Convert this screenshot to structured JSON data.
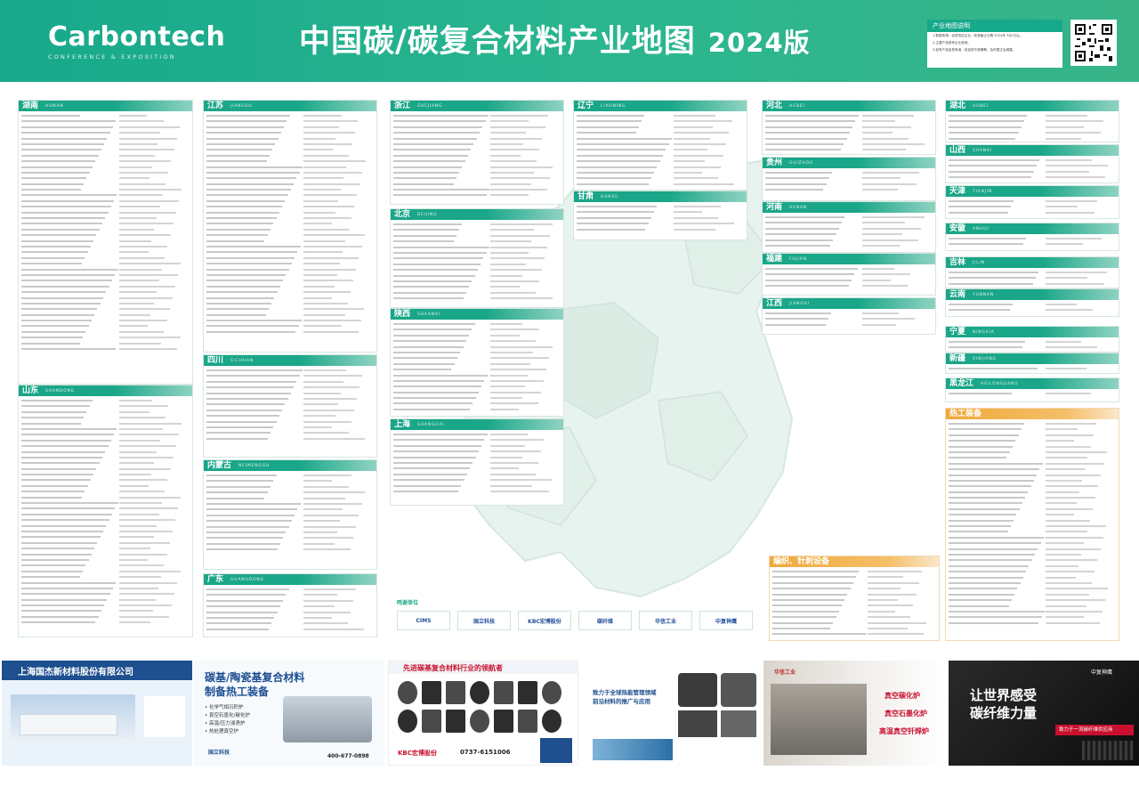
{
  "header": {
    "logo_main": "Carbontech",
    "logo_sub": "CONFERENCE & EXPOSITION",
    "title": "中国碳/碳复合材料产业地图",
    "year": "2024版",
    "note_title": "产业地图说明",
    "note_lines": [
      "1.数据来源：优质供应企业，收录截止日期 2024年 3月1日止。",
      "2.主要产品参考企业官网。",
      "3.如有产品信息有误，欢迎您不吝赐教，及时更正及调整。"
    ]
  },
  "regions": [
    {
      "name": "湖南",
      "en": "HUNAN",
      "rows": 42
    },
    {
      "name": "山东",
      "en": "SHANDONG",
      "rows": 40
    },
    {
      "name": "江苏",
      "en": "JIANGSU",
      "rows": 39
    },
    {
      "name": "四川",
      "en": "SICHUAN",
      "rows": 13
    },
    {
      "name": "内蒙古",
      "en": "NEIMENGGU",
      "rows": 14
    },
    {
      "name": "广东",
      "en": "GUANGDONG",
      "rows": 8
    },
    {
      "name": "浙江",
      "en": "ZHEJIANG",
      "rows": 15
    },
    {
      "name": "北京",
      "en": "BEIJING",
      "rows": 14
    },
    {
      "name": "陕西",
      "en": "SHAANXI",
      "rows": 16
    },
    {
      "name": "上海",
      "en": "SHANGHAI",
      "rows": 11
    },
    {
      "name": "辽宁",
      "en": "LIAONING",
      "rows": 13
    },
    {
      "name": "甘肃",
      "en": "GANSU",
      "rows": 5
    },
    {
      "name": "河北",
      "en": "HEBEI",
      "rows": 8
    },
    {
      "name": "贵州",
      "en": "GUIZHOU",
      "rows": 4
    },
    {
      "name": "河南",
      "en": "HENAN",
      "rows": 6
    },
    {
      "name": "福建",
      "en": "FUJIAN",
      "rows": 4
    },
    {
      "name": "江西",
      "en": "JIANGXI",
      "rows": 3
    },
    {
      "name": "湖北",
      "en": "HUBEI",
      "rows": 5
    },
    {
      "name": "山西",
      "en": "SHANXI",
      "rows": 4
    },
    {
      "name": "天津",
      "en": "TIANJIN",
      "rows": 3
    },
    {
      "name": "安徽",
      "en": "ANHUI",
      "rows": 2
    },
    {
      "name": "吉林",
      "en": "JILIN",
      "rows": 3
    },
    {
      "name": "云南",
      "en": "YUNNAN",
      "rows": 2
    },
    {
      "name": "宁夏",
      "en": "NINGXIA",
      "rows": 2
    },
    {
      "name": "新疆",
      "en": "XINJIANG",
      "rows": 1
    },
    {
      "name": "黑龙江",
      "en": "HEILONGJIANG",
      "rows": 1
    },
    {
      "name": "热工装备",
      "en": "",
      "rows": 36
    },
    {
      "name": "编织、针刺设备",
      "en": "",
      "rows": 14
    }
  ],
  "partners": {
    "label": "鸣谢单位",
    "logos": [
      "CIMS",
      "国立科技",
      "KBC宏博股份",
      "碳纤维",
      "华信工业",
      "中复神鹰"
    ]
  },
  "ads": {
    "ad1_title": "上海国杰新材料股份有限公司",
    "ad2_title": "碳基/陶瓷基复合材料",
    "ad2_title2": "制备热工装备",
    "ad2_items": [
      "• 化学气相沉积炉",
      "• 真空石墨化/碳化炉",
      "• 高温/压力浸渍炉",
      "• 热处理真空炉"
    ],
    "ad2_phone": "400-677-0898",
    "ad2_brand": "国立科技",
    "ad3_title": "先进碳基复合材料行业的领航者",
    "ad3_brand": "KBC宏博股份",
    "ad3_phone": "0737-6151006",
    "ad4_title": "致力于全球热能管理领域",
    "ad4_title2": "前沿材料的推广与应用",
    "ad5_lines": [
      "真空碳化炉",
      "真空石墨化炉",
      "高温真空钎焊炉"
    ],
    "ad5_brand": "华信工业",
    "ad6_title": "让世界感受",
    "ad6_title2": "碳纤维力量",
    "ad6_brand": "中复神鹰",
    "ad6_sub": "致力于一流碳纤维供应商"
  }
}
